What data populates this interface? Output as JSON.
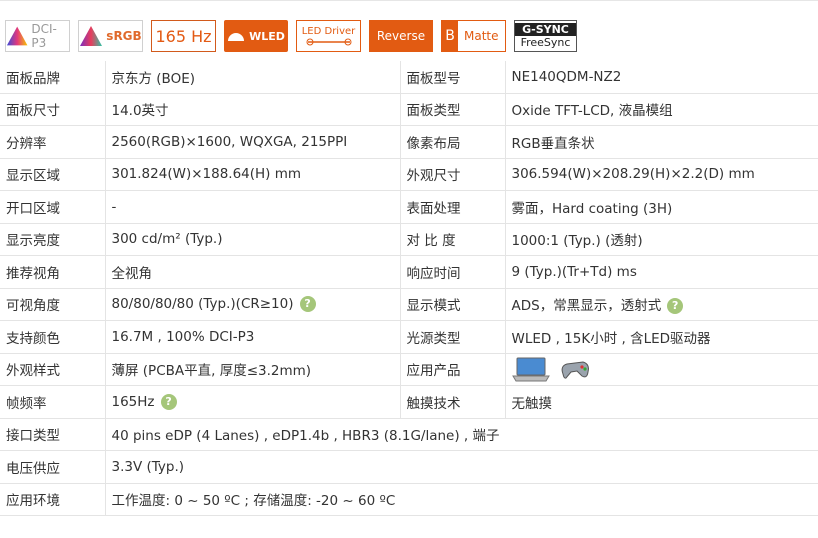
{
  "badges": {
    "dci": "DCI-P3",
    "srgb": "sRGB",
    "hz": "165 Hz",
    "wled": "WLED",
    "led_driver": "LED Driver",
    "reverse": "Reverse",
    "matte_letter": "B",
    "matte": "Matte",
    "gsync_top": "G-SYNC",
    "gsync_bottom": "FreeSync"
  },
  "rows": [
    {
      "k1": "面板品牌",
      "v1": "京东方 (BOE)",
      "k2": "面板型号",
      "v2": "NE140QDM-NZ2"
    },
    {
      "k1": "面板尺寸",
      "v1": "14.0英寸",
      "k2": "面板类型",
      "v2": "Oxide TFT-LCD, 液晶模组"
    },
    {
      "k1": "分辨率",
      "v1": "2560(RGB)×1600, WQXGA, 215PPI",
      "k2": "像素布局",
      "v2": "RGB垂直条状"
    },
    {
      "k1": "显示区域",
      "v1": "301.824(W)×188.64(H) mm",
      "k2": "外观尺寸",
      "v2": "306.594(W)×208.29(H)×2.2(D) mm"
    },
    {
      "k1": "开口区域",
      "v1": "-",
      "k2": "表面处理",
      "v2": "雾面，Hard coating (3H)"
    },
    {
      "k1": "显示亮度",
      "v1": "300 cd/m² (Typ.)",
      "k2": "对 比 度",
      "v2": "1000:1 (Typ.) (透射)"
    },
    {
      "k1": "推荐视角",
      "v1": "全视角",
      "k2": "响应时间",
      "v2": "9 (Typ.)(Tr+Td) ms"
    },
    {
      "k1": "可视角度",
      "v1": "80/80/80/80 (Typ.)(CR≥10)",
      "k2": "显示模式",
      "v2": "ADS，常黑显示，透射式"
    },
    {
      "k1": "支持颜色",
      "v1": "16.7M , 100% DCI-P3",
      "k2": "光源类型",
      "v2": "WLED , 15K小时 , 含LED驱动器"
    },
    {
      "k1": "外观样式",
      "v1": "薄屏 (PCBA平直, 厚度≤3.2mm)",
      "k2": "应用产品",
      "v2": ""
    },
    {
      "k1": "帧频率",
      "v1": "165Hz",
      "k2": "触摸技术",
      "v2": "无触摸"
    },
    {
      "k1": "接口类型",
      "v1": "40 pins   eDP (4 Lanes) , eDP1.4b , HBR3 (8.1G/lane) , 端子"
    },
    {
      "k1": "电压供应",
      "v1": "3.3V (Typ.)"
    },
    {
      "k1": "应用环境",
      "v1": "工作温度: 0 ~ 50 ºC ; 存储温度: -20 ~ 60 ºC"
    }
  ],
  "help_glyph": "?"
}
